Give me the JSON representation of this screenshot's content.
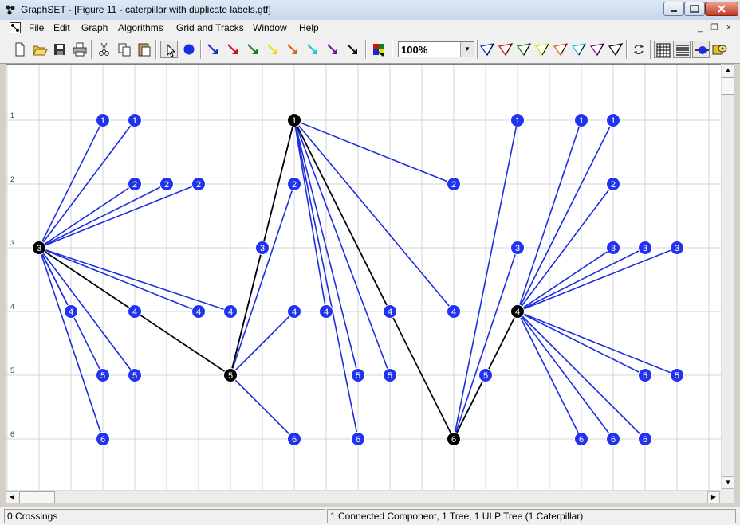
{
  "window": {
    "title": "GraphSET - [Figure 11 - caterpillar with duplicate labels.gtf]",
    "controls": {
      "minimize": "minimize-icon",
      "maximize": "maximize-icon",
      "close": "close-icon"
    }
  },
  "menu": {
    "items": [
      "File",
      "Edit",
      "Graph",
      "Algorithms",
      "Grid and Tracks",
      "Window",
      "Help"
    ],
    "mdi_controls": {
      "minimize": "_",
      "restore": "❐",
      "close": "×"
    }
  },
  "toolbar": {
    "zoom_value": "100%",
    "arrow_colors": [
      "#1030d0",
      "#d01010",
      "#108020",
      "#e8e000",
      "#e06010",
      "#10c8d8",
      "#8010a0",
      "#101010"
    ],
    "track_colors": [
      "#1030d0",
      "#d01010",
      "#108020",
      "#e8e000",
      "#e06010",
      "#10c8d8",
      "#8010a0",
      "#101010"
    ],
    "buttons": [
      "new-icon",
      "open-icon",
      "save-icon",
      "print-icon",
      "cut-icon",
      "copy-icon",
      "paste-icon",
      "select-pointer-icon",
      "add-vertex-icon",
      "color-fill-icon",
      "refresh-icon",
      "grid-icon",
      "tracks-icon",
      "vertex-style-icon",
      "color-palette-icon"
    ]
  },
  "canvas": {
    "track_labels": [
      "1",
      "2",
      "3",
      "4",
      "5",
      "6"
    ],
    "colors": {
      "edge": "#1a2ee0",
      "spine_edge": "#000000",
      "leaf": "#2233ee",
      "spine": "#000000",
      "grid": "#d4d4d4"
    }
  },
  "graph": {
    "spine_vertices": [
      {
        "id": "s3",
        "label": "3",
        "col": 1,
        "track": 3
      },
      {
        "id": "s5",
        "label": "5",
        "col": 7,
        "track": 5
      },
      {
        "id": "s1",
        "label": "1",
        "col": 9,
        "track": 1
      },
      {
        "id": "s6",
        "label": "6",
        "col": 14,
        "track": 6
      },
      {
        "id": "s4",
        "label": "4",
        "col": 16,
        "track": 4
      }
    ],
    "spine_edges": [
      [
        "s3",
        "s5"
      ],
      [
        "s5",
        "s1"
      ],
      [
        "s1",
        "s6"
      ],
      [
        "s6",
        "s4"
      ]
    ],
    "leaves": [
      {
        "label": "1",
        "col": 3,
        "track": 1,
        "parent": "s3"
      },
      {
        "label": "1",
        "col": 4,
        "track": 1,
        "parent": "s3"
      },
      {
        "label": "2",
        "col": 4,
        "track": 2,
        "parent": "s3"
      },
      {
        "label": "2",
        "col": 5,
        "track": 2,
        "parent": "s3"
      },
      {
        "label": "2",
        "col": 6,
        "track": 2,
        "parent": "s3"
      },
      {
        "label": "4",
        "col": 2,
        "track": 4,
        "parent": "s3"
      },
      {
        "label": "4",
        "col": 4,
        "track": 4,
        "parent": "s3"
      },
      {
        "label": "4",
        "col": 6,
        "track": 4,
        "parent": "s3"
      },
      {
        "label": "4",
        "col": 7,
        "track": 4,
        "parent": "s3"
      },
      {
        "label": "5",
        "col": 3,
        "track": 5,
        "parent": "s3"
      },
      {
        "label": "5",
        "col": 4,
        "track": 5,
        "parent": "s3"
      },
      {
        "label": "6",
        "col": 3,
        "track": 6,
        "parent": "s3"
      },
      {
        "label": "1",
        "col": 9,
        "track": 1,
        "parent": "s5"
      },
      {
        "label": "2",
        "col": 9,
        "track": 2,
        "parent": "s5"
      },
      {
        "label": "3",
        "col": 8,
        "track": 3,
        "parent": "s5"
      },
      {
        "label": "4",
        "col": 9,
        "track": 4,
        "parent": "s5"
      },
      {
        "label": "6",
        "col": 9,
        "track": 6,
        "parent": "s5"
      },
      {
        "label": "2",
        "col": 14,
        "track": 2,
        "parent": "s1"
      },
      {
        "label": "4",
        "col": 10,
        "track": 4,
        "parent": "s1"
      },
      {
        "label": "4",
        "col": 12,
        "track": 4,
        "parent": "s1"
      },
      {
        "label": "4",
        "col": 14,
        "track": 4,
        "parent": "s1"
      },
      {
        "label": "5",
        "col": 11,
        "track": 5,
        "parent": "s1"
      },
      {
        "label": "5",
        "col": 12,
        "track": 5,
        "parent": "s1"
      },
      {
        "label": "6",
        "col": 11,
        "track": 6,
        "parent": "s1"
      },
      {
        "label": "1",
        "col": 16,
        "track": 1,
        "parent": "s6"
      },
      {
        "label": "3",
        "col": 16,
        "track": 3,
        "parent": "s6"
      },
      {
        "label": "4",
        "col": 16,
        "track": 4,
        "parent": "s6"
      },
      {
        "label": "5",
        "col": 15,
        "track": 5,
        "parent": "s6"
      },
      {
        "label": "1",
        "col": 18,
        "track": 1,
        "parent": "s4"
      },
      {
        "label": "1",
        "col": 19,
        "track": 1,
        "parent": "s4"
      },
      {
        "label": "2",
        "col": 19,
        "track": 2,
        "parent": "s4"
      },
      {
        "label": "3",
        "col": 19,
        "track": 3,
        "parent": "s4"
      },
      {
        "label": "3",
        "col": 20,
        "track": 3,
        "parent": "s4"
      },
      {
        "label": "3",
        "col": 21,
        "track": 3,
        "parent": "s4"
      },
      {
        "label": "5",
        "col": 20,
        "track": 5,
        "parent": "s4"
      },
      {
        "label": "5",
        "col": 21,
        "track": 5,
        "parent": "s4"
      },
      {
        "label": "6",
        "col": 18,
        "track": 6,
        "parent": "s4"
      },
      {
        "label": "6",
        "col": 19,
        "track": 6,
        "parent": "s4"
      },
      {
        "label": "6",
        "col": 20,
        "track": 6,
        "parent": "s4"
      }
    ]
  },
  "status": {
    "left": "0 Crossings",
    "right": "1 Connected Component, 1 Tree, 1 ULP Tree (1 Caterpillar)"
  }
}
